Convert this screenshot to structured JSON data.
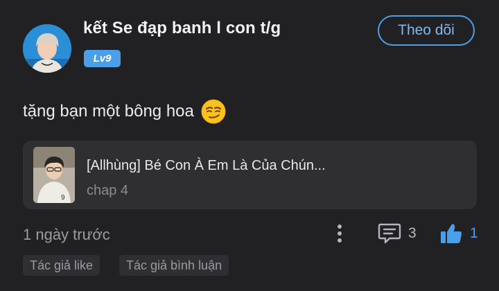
{
  "user": {
    "name": "kết Se đạp banh l con t/g",
    "level": "Lv9"
  },
  "follow_label": "Theo dõi",
  "comment": {
    "text": "tặng bạn một bông hoa",
    "emoji": "smirking-face"
  },
  "story": {
    "title": "[Allhùng] Bé Con À Em Là Của Chún...",
    "chapter": "chap 4"
  },
  "footer": {
    "time": "1 ngày trước",
    "reply_count": "3",
    "like_count": "1"
  },
  "tags": [
    "Tác giả like",
    "Tác giả bình luận"
  ],
  "colors": {
    "background": "#212123",
    "accent": "#4b9ee8",
    "card": "#2f2f32",
    "muted": "#9c9ca0"
  }
}
